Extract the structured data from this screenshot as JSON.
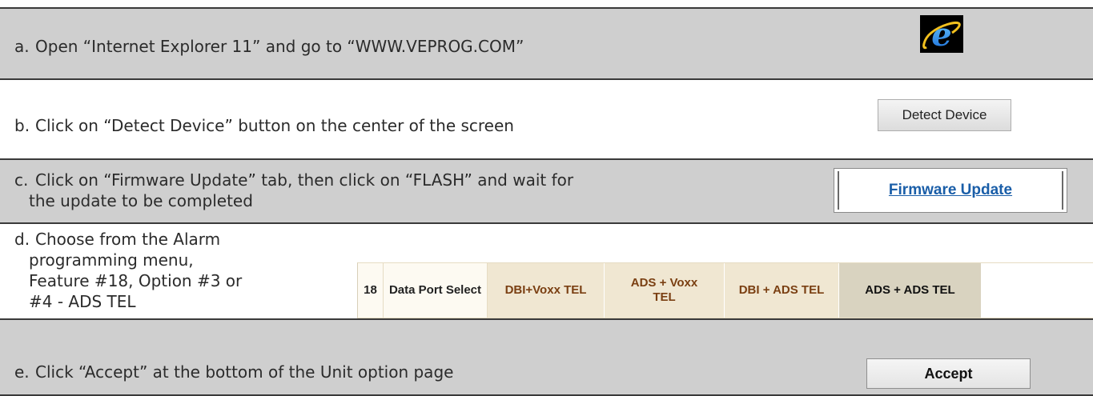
{
  "steps": [
    {
      "letter": "a.",
      "text": "Open “Internet Explorer 11” and go to “WWW.VEPROG.COM”"
    },
    {
      "letter": "b.",
      "text": "Click on “Detect Device” button on the center of the screen"
    },
    {
      "letter": "c.",
      "line1": "Click on “Firmware Update” tab, then click on “FLASH” and wait for",
      "line2": "the update to be completed"
    },
    {
      "letter": "d.",
      "line1": "Choose from the Alarm",
      "line2": "programming menu,",
      "line3": "Feature #18, Option #3 or",
      "line4": "#4 - ADS TEL"
    },
    {
      "letter": "e.",
      "text": "Click “Accept” at the bottom of the Unit option page"
    }
  ],
  "icons": {
    "ie": "internet-explorer-icon",
    "ie_color": "#1e8ae6"
  },
  "buttons": {
    "detect": "Detect Device",
    "firmware": "Firmware Update",
    "accept": "Accept"
  },
  "feature_row": {
    "number": "18",
    "name": "Data Port Select",
    "options": [
      {
        "line1": "DBI+Voxx TEL",
        "line2": ""
      },
      {
        "line1": "ADS + Voxx",
        "line2": "TEL"
      },
      {
        "line1": "DBI + ADS TEL",
        "line2": ""
      },
      {
        "line1": "ADS + ADS TEL",
        "line2": ""
      }
    ]
  },
  "colors": {
    "row_shade": "#cfcfcf",
    "link_blue": "#1a5ea8",
    "option_text": "#7a3f12"
  }
}
